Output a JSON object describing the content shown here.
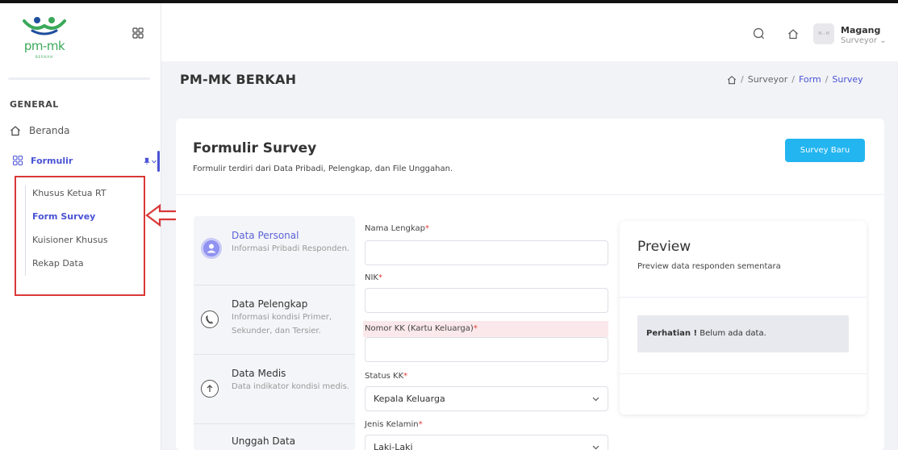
{
  "brand": {
    "logo_text": "pm-mk",
    "logo_sub": "BERKAH"
  },
  "sidebar": {
    "section": "GENERAL",
    "items": [
      {
        "label": "Beranda"
      },
      {
        "label": "Formulir"
      }
    ],
    "subitems": [
      {
        "label": "Khusus Ketua RT"
      },
      {
        "label": "Form Survey"
      },
      {
        "label": "Kuisioner Khusus"
      },
      {
        "label": "Rekap Data"
      }
    ]
  },
  "header": {
    "avatar_text": "M.-.M",
    "user_name": "Magang",
    "user_role": "Surveyor ⌄"
  },
  "page": {
    "title": "PM-MK BERKAH",
    "breadcrumb": [
      "Surveyor",
      "Form",
      "Survey"
    ]
  },
  "card": {
    "title": "Formulir Survey",
    "subtitle": "Formulir terdiri dari Data Pribadi, Pelengkap, dan File Unggahan.",
    "new_button": "Survey Baru"
  },
  "steps": [
    {
      "title": "Data Personal",
      "desc": "Informasi Pribadi Responden."
    },
    {
      "title": "Data Pelengkap",
      "desc": "Informasi kondisi Primer, Sekunder, dan Tersier."
    },
    {
      "title": "Data Medis",
      "desc": "Data indikator kondisi medis."
    },
    {
      "title": "Unggah Data",
      "desc": ""
    }
  ],
  "form": {
    "nama_label": "Nama Lengkap",
    "nik_label": "NIK",
    "kk_label": "Nomor KK (Kartu Keluarga)",
    "status_label": "Status KK",
    "status_value": "Kepala Keluarga",
    "gender_label": "Jenis Kelamin",
    "gender_value": "Laki-Laki",
    "required_mark": "*"
  },
  "preview": {
    "title": "Preview",
    "subtitle": "Preview data responden sementara",
    "alert_strong": "Perhatian !",
    "alert_text": " Belum ada data."
  },
  "colors": {
    "accent": "#4a53d4",
    "button": "#22b5f0",
    "highlight": "#d93838"
  }
}
